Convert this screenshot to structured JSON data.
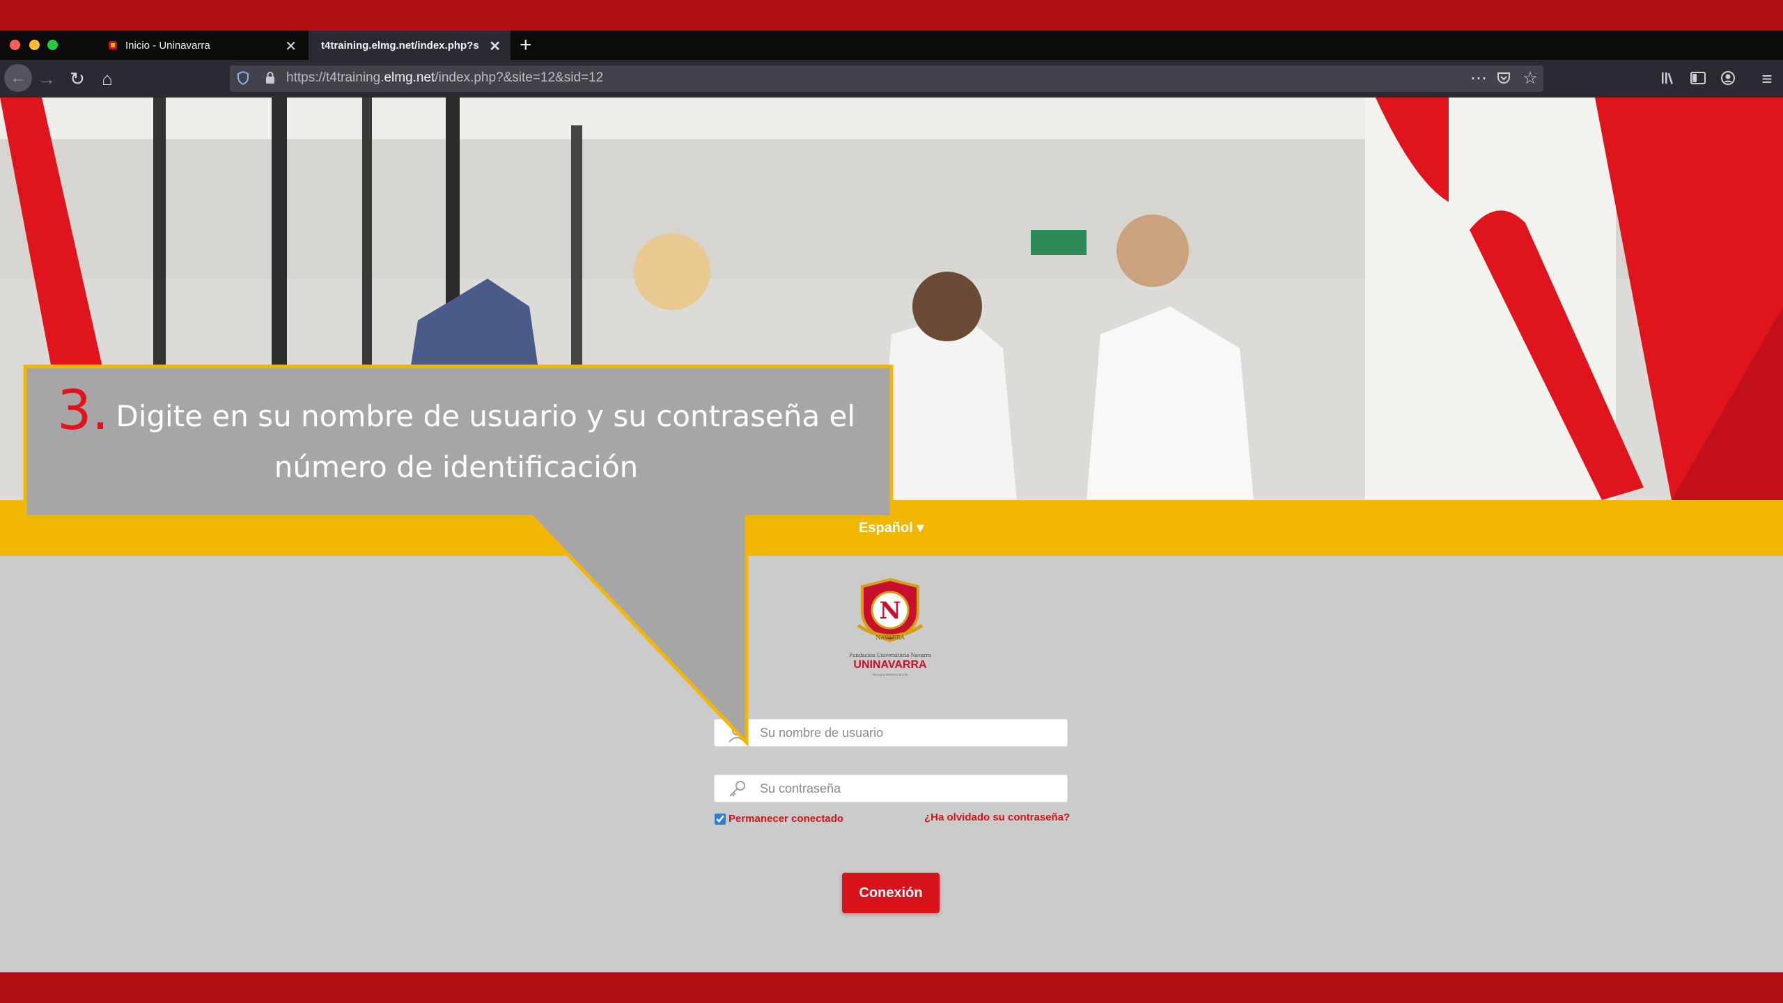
{
  "browser": {
    "tabs": [
      {
        "label": "Inicio - Uninavarra",
        "active": false
      },
      {
        "label": "t4training.elmg.net/index.php?s",
        "active": true
      }
    ],
    "url_prefix": "https://t4training.",
    "url_domain": "elmg.net",
    "url_path": "/index.php?&site=12&sid=12"
  },
  "page": {
    "language": "Español ▾",
    "logo": {
      "caption": "Fundación Universitaria Navarra",
      "brand": "UNINAVARRA",
      "crest_letter": "N",
      "crest_word": "NAVARRA",
      "tagline": "VIGILADA MINEDUCACIÓN"
    },
    "username_placeholder": "Su nombre de usuario",
    "password_placeholder": "Su contraseña",
    "remember_label": "Permanecer conectado",
    "forgot_label": "¿Ha olvidado su contraseña?",
    "connect_label": "Conexión"
  },
  "callout": {
    "number": "3.",
    "line1": "Digite en su nombre de usuario y su contraseña el",
    "line2": "número de identificación"
  },
  "colors": {
    "brand_red": "#d7141c",
    "accent_yellow": "#f2b705",
    "callout_fill": "#a6a6a6"
  }
}
